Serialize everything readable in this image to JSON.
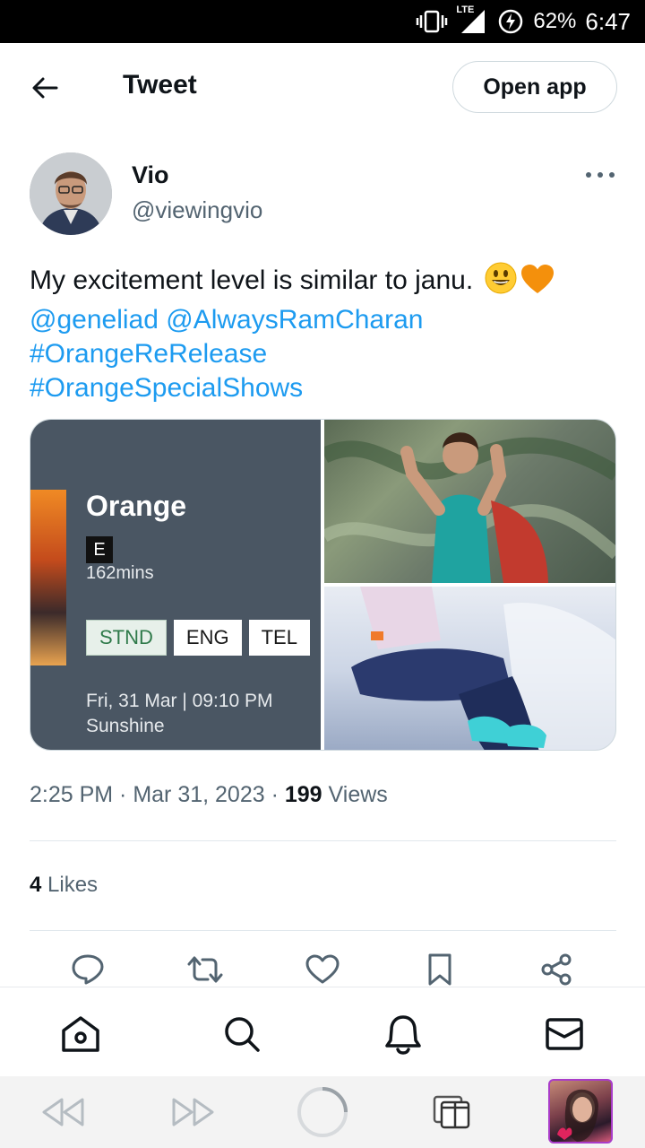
{
  "status_bar": {
    "network": "LTE",
    "battery": "62%",
    "time": "6:47"
  },
  "header": {
    "title": "Tweet",
    "open_app_label": "Open app"
  },
  "tweet": {
    "author_name": "Vio",
    "author_handle": "@viewingvio",
    "text": "My excitement level is similar to janu.",
    "emojis": [
      "smiley-emoji",
      "orange-heart-emoji"
    ],
    "mentions": [
      "@geneliad",
      "@AlwaysRamCharan"
    ],
    "hashtags": [
      "#OrangeReRelease",
      "#OrangeSpecialShows"
    ],
    "media": {
      "ticket": {
        "title": "Orange",
        "rating": "E",
        "duration": "162mins",
        "tags": [
          "STND",
          "ENG",
          "TEL"
        ],
        "selected_tag": "STND",
        "date_time": "Fri, 31 Mar | 09:10 PM",
        "venue": "Sunshine"
      }
    },
    "time": "2:25 PM",
    "date": "Mar 31, 2023",
    "views_count": "199",
    "views_label": "Views",
    "likes_count": "4",
    "likes_label": "Likes"
  },
  "actions": [
    "reply-icon",
    "retweet-icon",
    "like-icon",
    "bookmark-icon",
    "share-icon"
  ],
  "bottom_nav": [
    "home-icon",
    "search-icon",
    "notifications-icon",
    "messages-icon"
  ],
  "colors": {
    "link": "#1d9bf0",
    "secondary_text": "#536471",
    "primary_text": "#0f1419"
  }
}
